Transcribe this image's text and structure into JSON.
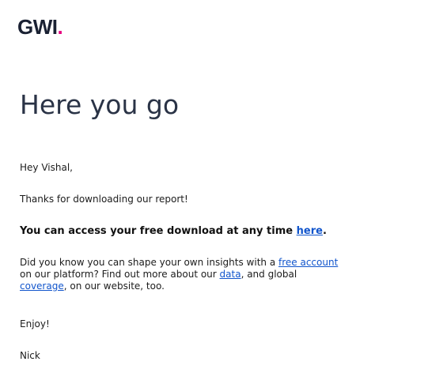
{
  "brand": {
    "logo_text": "GWI",
    "logo_dot": ".",
    "accent_color": "#e6007e"
  },
  "email": {
    "heading": "Here you go",
    "greeting": "Hey Vishal,",
    "thanks": "Thanks for downloading our report!",
    "access_text": "You can access your free download at any time ",
    "access_link": "here",
    "access_end": ".",
    "insights_part1": "Did you know you can shape your own insights with a ",
    "free_account_link": "free account",
    "insights_part2": " on our platform? Find out more about our ",
    "data_link": "data",
    "insights_part3": ", and global ",
    "coverage_link": "coverage",
    "insights_part4": ", on our website, too.",
    "signoff": "Enjoy!",
    "signature": "Nick"
  },
  "colors": {
    "link": "#1155cc",
    "heading": "#2a3346"
  }
}
